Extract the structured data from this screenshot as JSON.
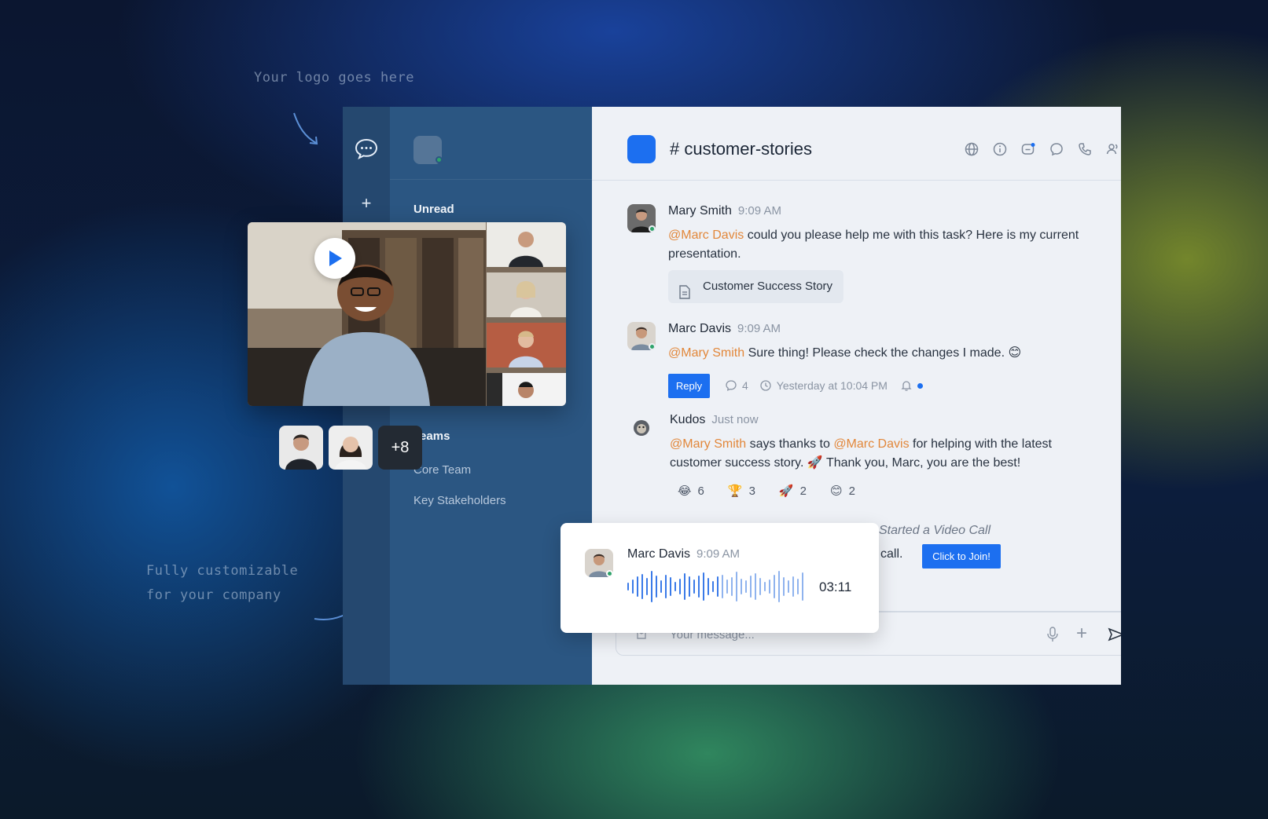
{
  "annotations": {
    "logo_note": "Your logo goes here",
    "custom_note_line1": "Fully customizable",
    "custom_note_line2": "for your company"
  },
  "sidebar": {
    "unread_label": "Unread",
    "teams_label": "Teams",
    "teams": [
      "Core Team",
      "Key Stakeholders"
    ]
  },
  "channel": {
    "title": "# customer-stories",
    "header_icons": [
      "globe-icon",
      "info-icon",
      "notification-chat-icon",
      "chat-bubble-icon",
      "phone-icon",
      "members-icon"
    ]
  },
  "messages": [
    {
      "author": "Mary Smith",
      "time": "9:09 AM",
      "mention": "@Marc Davis",
      "text": " could you please help me with this task? Here is my current presentation.",
      "attachment": "Customer Success Story"
    },
    {
      "author": "Marc Davis",
      "time": "9:09 AM",
      "mention": "@Mary Smith",
      "text": " Sure thing! Please check the changes I made. 😊",
      "reply_label": "Reply",
      "reply_count": "4",
      "thread_time": "Yesterday at 10:04 PM"
    },
    {
      "author": "Kudos",
      "time": "Just now",
      "mention1": "@Mary Smith",
      "text1": " says thanks to ",
      "mention2": "@Marc Davis",
      "text2": " for helping with the latest customer success story. 🚀 Thank you, Marc, you are the best!",
      "reactions": [
        {
          "emoji": "😂",
          "count": "6"
        },
        {
          "emoji": "🏆",
          "count": "3"
        },
        {
          "emoji": "🚀",
          "count": "2"
        },
        {
          "emoji": "😊",
          "count": "2"
        }
      ]
    }
  ],
  "video_call": {
    "label": "Started a Video Call",
    "call_text": "call.",
    "join_label": "Click to Join!"
  },
  "voice_message": {
    "author": "Marc Davis",
    "time": "9:09 AM",
    "duration": "03:11"
  },
  "participants": {
    "more_count": "+8"
  },
  "composer": {
    "placeholder": "Your message..."
  },
  "colors": {
    "accent": "#1c6ff0",
    "mention": "#e2873a",
    "online": "#2fa36b"
  }
}
